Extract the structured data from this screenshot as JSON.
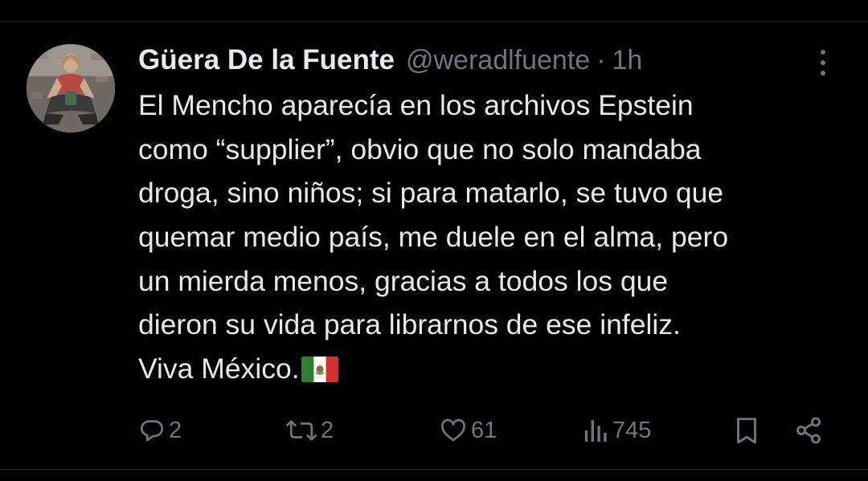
{
  "tweet": {
    "author_name": "Güera De la Fuente",
    "handle": "@weradlfuente",
    "separator": "·",
    "time": "1h",
    "text_lines": [
      "El Mencho aparecía en los archivos Epstein",
      "como “supplier”, obvio que no solo mandaba",
      "droga, sino niños; si para matarlo, se tuvo que",
      "quemar medio país, me duele en el alma, pero",
      "un mierda menos, gracias a todos los que",
      "dieron su vida para librarnos de ese infeliz.",
      "Viva México."
    ],
    "emoji": "mexico-flag"
  },
  "actions": {
    "replies": "2",
    "reposts": "2",
    "likes": "61",
    "views": "745"
  },
  "icons": [
    "reply-icon",
    "repost-icon",
    "like-icon",
    "views-icon",
    "bookmark-icon",
    "share-icon",
    "more-options-icon"
  ],
  "colors": {
    "background": "#000000",
    "text_primary": "#e7e9ea",
    "text_secondary": "#71767b",
    "divider": "#2a2a2a"
  }
}
